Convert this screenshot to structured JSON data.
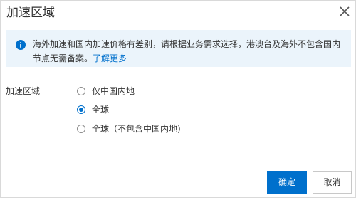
{
  "dialog": {
    "title": "加速区域",
    "close_icon": "close-icon"
  },
  "notice": {
    "icon": "info-icon",
    "text": "海外加速和国内加速价格有差别，请根据业务需求选择，港澳台及海外不包含国内节点无需备案。",
    "link": "了解更多"
  },
  "form": {
    "label": "加速区域",
    "options": [
      {
        "label": "仅中国内地",
        "checked": false
      },
      {
        "label": "全球",
        "checked": true
      },
      {
        "label": "全球（不包含中国内地)",
        "checked": false
      }
    ]
  },
  "footer": {
    "confirm_label": "确定",
    "cancel_label": "取消"
  },
  "colors": {
    "primary": "#0070cc",
    "notice_bg": "#ebf4fb",
    "text": "#333333"
  }
}
